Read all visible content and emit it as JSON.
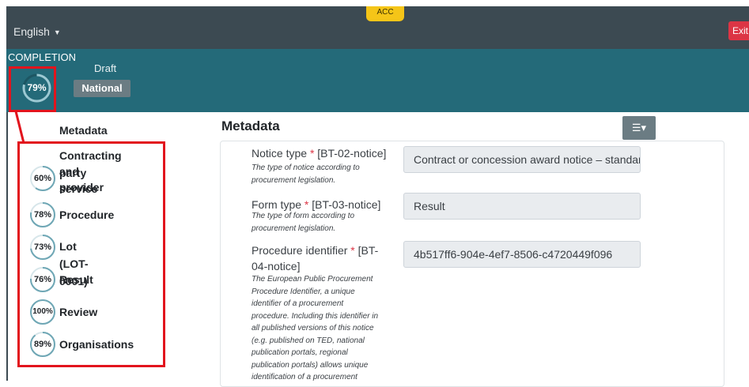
{
  "header": {
    "language": "English",
    "env_badge": "ACC",
    "exit_label": "Exit"
  },
  "status": {
    "completion_label": "COMPLETION",
    "completion_percent": "79%",
    "completion_value": 0.79,
    "draft_label": "Draft",
    "national_badge": "National",
    "filter_icon": "sliders-icon"
  },
  "sidebar": {
    "metadata_label": "Metadata",
    "items": [
      {
        "percent": "60%",
        "value": 0.6,
        "label_lines": [
          "Contracting party",
          "and service",
          "provider"
        ]
      },
      {
        "percent": "78%",
        "value": 0.78,
        "label": "Procedure"
      },
      {
        "percent": "73%",
        "value": 0.73,
        "label": "Lot (LOT-0001)"
      },
      {
        "percent": "76%",
        "value": 0.76,
        "label": "Result"
      },
      {
        "percent": "100%",
        "value": 1.0,
        "label": "Review"
      },
      {
        "percent": "89%",
        "value": 0.89,
        "label": "Organisations"
      }
    ]
  },
  "main": {
    "title": "Metadata",
    "fields": [
      {
        "label_lines": [
          "Notice type",
          "[BT-02-notice]"
        ],
        "help_lines": [
          "The type of notice according to",
          "procurement legislation."
        ],
        "value": "Contract or concession award notice – standard"
      },
      {
        "label_lines": [
          "Form type",
          "[BT-03-notice]"
        ],
        "help_lines": [
          "The type of form according to",
          "procurement legislation."
        ],
        "value": "Result"
      },
      {
        "label_lines": [
          "Procedure identifier",
          "[BT-",
          "04-notice]"
        ],
        "help_lines": [
          "The European Public Procurement",
          "Procedure Identifier, a unique",
          "identifier of a procurement",
          "procedure. Including this identifier in",
          "all published versions of this notice",
          "(e.g. published on TED, national",
          "publication portals, regional",
          "publication portals) allows unique",
          "identification of a procurement"
        ],
        "value": "4b517ff6-904e-4ef7-8506-c4720449f096"
      }
    ]
  },
  "colors": {
    "topbar": "#3c4a52",
    "statusbar": "#246a79",
    "highlight": "#e2141d",
    "gauge_stroke": "#6fa7b5",
    "required": "#dc3545"
  }
}
